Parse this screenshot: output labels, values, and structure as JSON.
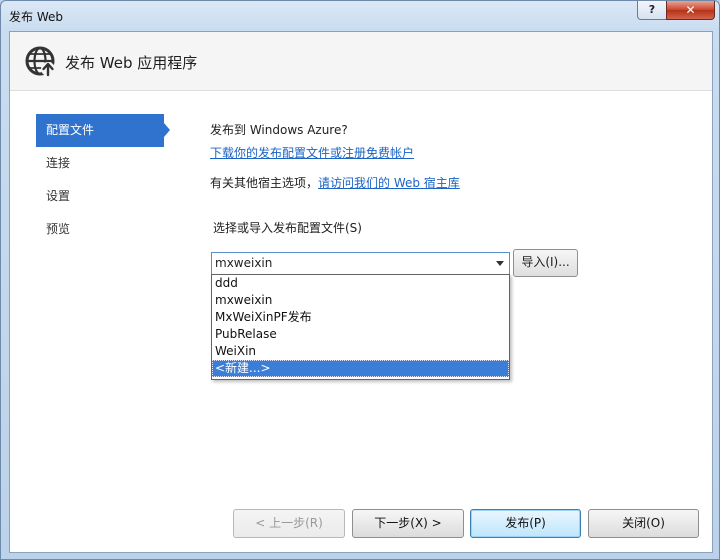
{
  "window": {
    "title": "发布 Web",
    "help_glyph": "?",
    "close_glyph": "✕"
  },
  "header": {
    "title": "发布 Web 应用程序",
    "icon": "globe-publish-icon"
  },
  "nav": {
    "items": [
      {
        "label": "配置文件",
        "active": true
      },
      {
        "label": "连接"
      },
      {
        "label": "设置"
      },
      {
        "label": "预览"
      }
    ]
  },
  "content": {
    "publish_to": "发布到 Windows Azure?",
    "download_link": "下载你的发布配置文件或注册免费帐户",
    "other_hosts_prefix": "有关其他宿主选项，",
    "other_hosts_link": "请访问我们的 Web 宿主库",
    "select_label": "选择或导入发布配置文件(S)",
    "combo_value": "mxweixin",
    "import_label": "导入(I)...",
    "dropdown_options": [
      "ddd",
      "mxweixin",
      "MxWeiXinPF发布",
      "PubRelase",
      "WeiXin",
      "<新建...>"
    ],
    "dropdown_selected_index": 5
  },
  "footer": {
    "prev_label": "< 上一步(R)",
    "next_label": "下一步(X) >",
    "publish_label": "发布(P)",
    "close_label": "关闭(O)"
  },
  "colors": {
    "nav_active": "#2f73cf",
    "link": "#1a63c4",
    "dropdown_selected": "#3b7ed8"
  }
}
